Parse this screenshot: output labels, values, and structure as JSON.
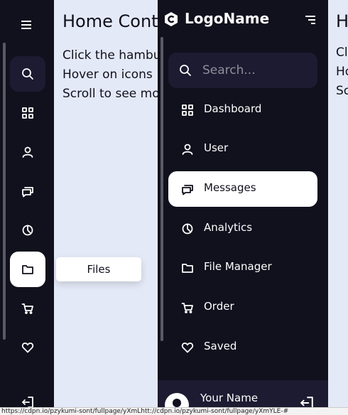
{
  "home": {
    "title": "Home Content",
    "lines": [
      "Click the hamburger icon",
      "Hover on icons",
      "Scroll to see more"
    ]
  },
  "sidebar": {
    "logo_name": "LogoName",
    "search_placeholder": "Search...",
    "items": [
      {
        "label": "Dashboard",
        "icon": "grid-icon"
      },
      {
        "label": "User",
        "icon": "user-icon"
      },
      {
        "label": "Messages",
        "icon": "chat-icon"
      },
      {
        "label": "Analytics",
        "icon": "pie-chart-icon"
      },
      {
        "label": "File Manager",
        "icon": "folder-icon"
      },
      {
        "label": "Order",
        "icon": "cart-icon"
      },
      {
        "label": "Saved",
        "icon": "heart-icon"
      }
    ],
    "profile_name": "Your Name"
  },
  "tooltip": {
    "text": "Files"
  },
  "status_bar": {
    "url": "https://cdpn.io/pzykumi-sont/fullpage/yXmLhtt://cdpn.io/pzykumi-sont/fullpage/yXmYLE-#"
  },
  "colors": {
    "sidebar_bg": "#11101d",
    "item_bg": "#1d1b31",
    "page_bg": "#e4e9f7",
    "active_bg": "#ffffff"
  }
}
